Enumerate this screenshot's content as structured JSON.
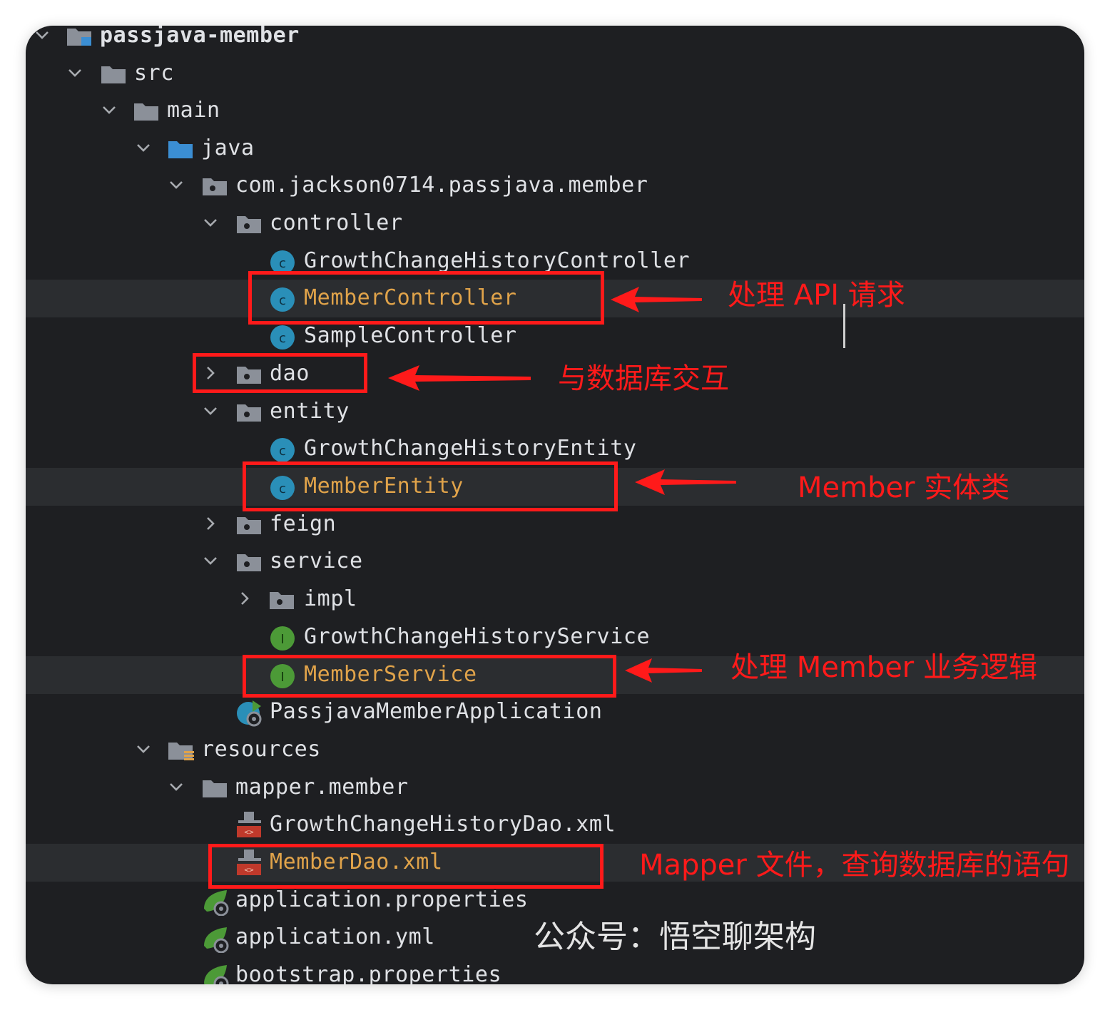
{
  "project_tree": {
    "root": "passjava-member",
    "items": {
      "src": "src",
      "main": "main",
      "java": "java",
      "package": "com.jackson0714.passjava.member",
      "controller": "controller",
      "growth_controller": "GrowthChangeHistoryController",
      "member_controller": "MemberController",
      "sample_controller": "SampleController",
      "dao": "dao",
      "entity": "entity",
      "growth_entity": "GrowthChangeHistoryEntity",
      "member_entity": "MemberEntity",
      "feign": "feign",
      "service": "service",
      "impl": "impl",
      "growth_service": "GrowthChangeHistoryService",
      "member_service": "MemberService",
      "application_class": "PassjavaMemberApplication",
      "resources": "resources",
      "mapper_member": "mapper.member",
      "growth_dao_xml": "GrowthChangeHistoryDao.xml",
      "member_dao_xml": "MemberDao.xml",
      "application_properties": "application.properties",
      "application_yml": "application.yml",
      "bootstrap_properties": "bootstrap.properties"
    }
  },
  "annotations": {
    "controller_note": "处理 API 请求",
    "dao_note": "与数据库交互",
    "entity_note": "Member 实体类",
    "service_note": "处理 Member 业务逻辑",
    "mapper_note": "Mapper 文件，查询数据库的语句"
  },
  "watermark": "公众号：悟空聊架构",
  "colors": {
    "panel_background": "#1e1f22",
    "highlight_row": "#2b2d30",
    "text": "#dfe1e5",
    "modified_text": "#e0a34a",
    "annotation_red": "#ff1a1a",
    "class_icon": "#2a8fb8",
    "interface_icon": "#4c9a37",
    "folder_icon": "#8b9099",
    "source_folder_icon": "#3b8ed3"
  },
  "icons": {
    "folder": "folder-icon",
    "source_folder": "source-folder-icon",
    "package": "package-icon",
    "class": "class-icon",
    "interface": "interface-icon",
    "spring_boot": "spring-boot-icon",
    "xml": "xml-file-icon",
    "resources": "resources-folder-icon"
  }
}
